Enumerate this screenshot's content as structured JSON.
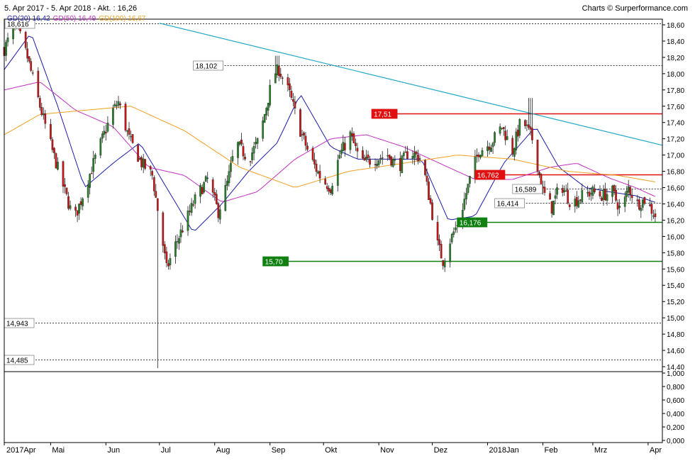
{
  "header": {
    "range": "5. Apr 2017 - 5. Apr 2018 - Akt. : 16,26",
    "source": "Charts © Surperformance.com"
  },
  "legend": [
    {
      "label": "GD(20)",
      "value": "16,42",
      "color": "#1b1ba8"
    },
    {
      "label": "GD(50)",
      "value": "16,49",
      "color": "#c030c0"
    },
    {
      "label": "GD(100)",
      "value": "16,67",
      "color": "#f0a020"
    }
  ],
  "colors": {
    "up": "#2c7a2c",
    "down": "#c01818",
    "wick": "#202020",
    "trend": "#21a8c8",
    "resistance": "#e01010",
    "support": "#108010",
    "grid": "#808080"
  },
  "chart_data": [
    {
      "type": "candlestick",
      "y_ticks": [
        "18,60",
        "18,40",
        "18,20",
        "18,00",
        "17,80",
        "17,60",
        "17,40",
        "17,20",
        "17,00",
        "16,80",
        "16,60",
        "16,40",
        "16,20",
        "16,00",
        "15,80",
        "15,60",
        "15,40",
        "15,20",
        "15,00",
        "14,80",
        "14,60",
        "14,40"
      ],
      "x_ticks": [
        {
          "label": "2017Apr",
          "date": "2017-04-05"
        },
        {
          "label": "Mai",
          "date": "2017-05-01"
        },
        {
          "label": "Jun",
          "date": "2017-06-01"
        },
        {
          "label": "Jul",
          "date": "2017-07-01"
        },
        {
          "label": "Aug",
          "date": "2017-08-01"
        },
        {
          "label": "Sep",
          "date": "2017-09-01"
        },
        {
          "label": "Okt",
          "date": "2017-10-01"
        },
        {
          "label": "Nov",
          "date": "2017-11-01"
        },
        {
          "label": "Dez",
          "date": "2017-12-01"
        },
        {
          "label": "2018Jan",
          "date": "2018-01-01"
        },
        {
          "label": "Feb",
          "date": "2018-02-01"
        },
        {
          "label": "Mrz",
          "date": "2018-03-01"
        },
        {
          "label": "Apr",
          "date": "2018-04-01"
        }
      ],
      "ylim": [
        14.3,
        18.7
      ],
      "price_points": [
        [
          "2017-04-05",
          18.3
        ],
        [
          "2017-04-10",
          18.55
        ],
        [
          "2017-04-13",
          18.52
        ],
        [
          "2017-04-18",
          18.2
        ],
        [
          "2017-04-25",
          17.6
        ],
        [
          "2017-05-02",
          17.05
        ],
        [
          "2017-05-09",
          16.55
        ],
        [
          "2017-05-14",
          16.2
        ],
        [
          "2017-05-19",
          16.5
        ],
        [
          "2017-05-25",
          16.9
        ],
        [
          "2017-05-30",
          17.2
        ],
        [
          "2017-06-05",
          17.55
        ],
        [
          "2017-06-08",
          17.65
        ],
        [
          "2017-06-14",
          17.2
        ],
        [
          "2017-06-21",
          16.9
        ],
        [
          "2017-06-27",
          16.75
        ],
        [
          "2017-07-02",
          16.05
        ],
        [
          "2017-07-05",
          15.6
        ],
        [
          "2017-07-10",
          15.9
        ],
        [
          "2017-07-16",
          16.2
        ],
        [
          "2017-07-22",
          16.5
        ],
        [
          "2017-07-28",
          16.7
        ],
        [
          "2017-08-03",
          16.3
        ],
        [
          "2017-08-08",
          16.65
        ],
        [
          "2017-08-13",
          17.15
        ],
        [
          "2017-08-20",
          16.95
        ],
        [
          "2017-08-26",
          17.2
        ],
        [
          "2017-08-30",
          17.6
        ],
        [
          "2017-09-03",
          18.0
        ],
        [
          "2017-09-06",
          18.05
        ],
        [
          "2017-09-12",
          17.75
        ],
        [
          "2017-09-18",
          17.3
        ],
        [
          "2017-09-24",
          16.95
        ],
        [
          "2017-09-30",
          16.7
        ],
        [
          "2017-10-05",
          16.6
        ],
        [
          "2017-10-10",
          17.0
        ],
        [
          "2017-10-16",
          17.25
        ],
        [
          "2017-10-22",
          16.9
        ],
        [
          "2017-10-30",
          16.95
        ],
        [
          "2017-11-06",
          17.0
        ],
        [
          "2017-11-12",
          16.85
        ],
        [
          "2017-11-18",
          17.05
        ],
        [
          "2017-11-25",
          16.95
        ],
        [
          "2017-11-30",
          16.4
        ],
        [
          "2017-12-04",
          15.9
        ],
        [
          "2017-12-07",
          15.7
        ],
        [
          "2017-12-11",
          15.95
        ],
        [
          "2017-12-16",
          16.2
        ],
        [
          "2017-12-22",
          16.7
        ],
        [
          "2017-12-27",
          17.05
        ],
        [
          "2018-01-03",
          17.15
        ],
        [
          "2018-01-09",
          17.35
        ],
        [
          "2018-01-15",
          17.05
        ],
        [
          "2018-01-20",
          17.45
        ],
        [
          "2018-01-26",
          17.2
        ],
        [
          "2018-02-01",
          16.55
        ],
        [
          "2018-02-06",
          16.35
        ],
        [
          "2018-02-11",
          16.65
        ],
        [
          "2018-02-17",
          16.4
        ],
        [
          "2018-02-23",
          16.5
        ],
        [
          "2018-03-01",
          16.55
        ],
        [
          "2018-03-06",
          16.5
        ],
        [
          "2018-03-12",
          16.55
        ],
        [
          "2018-03-17",
          16.3
        ],
        [
          "2018-03-21",
          16.6
        ],
        [
          "2018-03-26",
          16.4
        ],
        [
          "2018-03-30",
          16.45
        ],
        [
          "2018-04-05",
          16.26
        ]
      ],
      "moving_averages": [
        {
          "name": "GD(20)",
          "color": "#1b1ba8",
          "points": [
            [
              "2017-04-05",
              18.05
            ],
            [
              "2017-04-20",
              18.5
            ],
            [
              "2017-05-05",
              17.6
            ],
            [
              "2017-05-20",
              16.6
            ],
            [
              "2017-06-05",
              16.9
            ],
            [
              "2017-06-20",
              17.15
            ],
            [
              "2017-07-05",
              16.6
            ],
            [
              "2017-07-20",
              16.05
            ],
            [
              "2017-08-05",
              16.4
            ],
            [
              "2017-08-20",
              16.8
            ],
            [
              "2017-09-05",
              17.15
            ],
            [
              "2017-09-18",
              17.75
            ],
            [
              "2017-10-05",
              17.1
            ],
            [
              "2017-10-20",
              16.95
            ],
            [
              "2017-11-05",
              16.95
            ],
            [
              "2017-11-25",
              16.95
            ],
            [
              "2017-12-10",
              16.2
            ],
            [
              "2017-12-25",
              16.25
            ],
            [
              "2018-01-10",
              16.9
            ],
            [
              "2018-01-28",
              17.35
            ],
            [
              "2018-02-10",
              16.85
            ],
            [
              "2018-02-25",
              16.6
            ],
            [
              "2018-03-10",
              16.55
            ],
            [
              "2018-03-25",
              16.5
            ],
            [
              "2018-04-05",
              16.42
            ]
          ]
        },
        {
          "name": "GD(50)",
          "color": "#c030c0",
          "points": [
            [
              "2017-04-05",
              17.8
            ],
            [
              "2017-04-25",
              17.9
            ],
            [
              "2017-05-15",
              17.55
            ],
            [
              "2017-06-05",
              17.35
            ],
            [
              "2017-06-25",
              16.85
            ],
            [
              "2017-07-15",
              16.75
            ],
            [
              "2017-08-05",
              16.42
            ],
            [
              "2017-08-25",
              16.55
            ],
            [
              "2017-09-15",
              16.95
            ],
            [
              "2017-10-05",
              17.2
            ],
            [
              "2017-10-25",
              17.25
            ],
            [
              "2017-11-15",
              17.1
            ],
            [
              "2017-12-05",
              16.9
            ],
            [
              "2017-12-25",
              16.7
            ],
            [
              "2018-01-15",
              16.7
            ],
            [
              "2018-02-05",
              16.85
            ],
            [
              "2018-02-20",
              16.9
            ],
            [
              "2018-03-10",
              16.72
            ],
            [
              "2018-03-25",
              16.6
            ],
            [
              "2018-04-05",
              16.49
            ]
          ]
        },
        {
          "name": "GD(100)",
          "color": "#f0a020",
          "points": [
            [
              "2017-04-05",
              17.25
            ],
            [
              "2017-04-25",
              17.5
            ],
            [
              "2017-05-20",
              17.55
            ],
            [
              "2017-06-15",
              17.6
            ],
            [
              "2017-07-15",
              17.3
            ],
            [
              "2017-08-15",
              16.85
            ],
            [
              "2017-09-15",
              16.6
            ],
            [
              "2017-10-15",
              16.8
            ],
            [
              "2017-11-15",
              16.9
            ],
            [
              "2017-12-15",
              17.0
            ],
            [
              "2018-01-15",
              16.95
            ],
            [
              "2018-02-15",
              16.8
            ],
            [
              "2018-03-15",
              16.75
            ],
            [
              "2018-04-05",
              16.67
            ]
          ]
        }
      ],
      "trendline": {
        "from": [
          "2017-07-01",
          18.62
        ],
        "to": [
          "2018-04-09",
          17.12
        ]
      },
      "horizontal_lines": [
        {
          "label": "18,616",
          "value": 18.616,
          "from": "2017-04-05",
          "to": "2018-04-09",
          "style": "dashed",
          "color": "#000000",
          "badge": "plain"
        },
        {
          "label": "18,102",
          "value": 18.102,
          "from": "2017-07-20",
          "to": "2018-04-09",
          "style": "dashed",
          "color": "#000000",
          "badge": "plain"
        },
        {
          "label": "17,51",
          "value": 17.51,
          "from": "2017-10-28",
          "to": "2018-04-09",
          "style": "solid",
          "color": "#e01010",
          "badge": "red"
        },
        {
          "label": "16,762",
          "value": 16.762,
          "from": "2017-12-25",
          "to": "2018-04-09",
          "style": "solid",
          "color": "#e01010",
          "badge": "red"
        },
        {
          "label": "16,589",
          "value": 16.589,
          "from": "2018-01-15",
          "to": "2018-04-09",
          "style": "dashed",
          "color": "#000000",
          "badge": "plain"
        },
        {
          "label": "16,414",
          "value": 16.414,
          "from": "2018-01-05",
          "to": "2018-04-09",
          "style": "dashed",
          "color": "#000000",
          "badge": "plain"
        },
        {
          "label": "16,176",
          "value": 16.176,
          "from": "2017-12-15",
          "to": "2018-04-09",
          "style": "solid",
          "color": "#108010",
          "badge": "green"
        },
        {
          "label": "15,70",
          "value": 15.7,
          "from": "2017-08-28",
          "to": "2018-04-09",
          "style": "solid",
          "color": "#108010",
          "badge": "green"
        },
        {
          "label": "14,943",
          "value": 14.943,
          "from": "2017-04-05",
          "to": "2018-04-09",
          "style": "dashed",
          "color": "#000000",
          "badge": "plain"
        },
        {
          "label": "14,485",
          "value": 14.485,
          "from": "2017-04-05",
          "to": "2018-04-09",
          "style": "dashed",
          "color": "#000000",
          "badge": "plain"
        }
      ],
      "extremes": [
        {
          "date": "2017-07-01",
          "value": 14.38
        },
        {
          "date": "2017-09-05",
          "value": 18.22
        },
        {
          "date": "2018-01-25",
          "value": 17.7
        }
      ]
    },
    {
      "type": "volume",
      "y_ticks": [
        "1,000",
        "0,800",
        "0,600",
        "0,400",
        "0,200",
        "0,000"
      ],
      "ylim": [
        0,
        1.0
      ]
    }
  ]
}
